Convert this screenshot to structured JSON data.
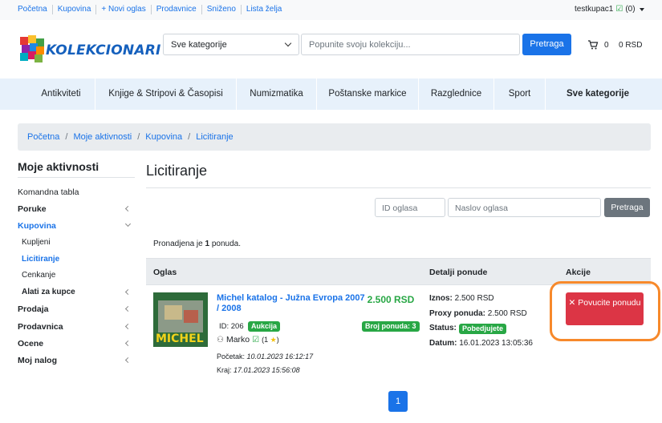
{
  "top_links": [
    "Početna",
    "Kupovina",
    "+ Novi oglas",
    "Prodavnice",
    "Sniženo",
    "Lista želja"
  ],
  "user": {
    "name": "testkupac1",
    "count": "(0)"
  },
  "header": {
    "logo_text": "KOLEKCIONARI",
    "category_select": "Sve kategorije",
    "search_placeholder": "Popunite svoju kolekciju...",
    "search_button": "Pretraga",
    "cart_count": "0",
    "cart_total": "0 RSD"
  },
  "categories": [
    "Antikviteti",
    "Knjige & Stripovi & Časopisi",
    "Numizmatika",
    "Poštanske markice",
    "Razglednice",
    "Sport",
    "Sve kategorije"
  ],
  "breadcrumb": [
    "Početna",
    "Moje aktivnosti",
    "Kupovina",
    "Licitiranje"
  ],
  "sidebar": {
    "title": "Moje aktivnosti",
    "items": {
      "komandna": "Komandna tabla",
      "poruke": "Poruke",
      "kupovina": "Kupovina",
      "kupljeni": "Kupljeni",
      "licitiranje": "Licitiranje",
      "cenkanje": "Cenkanje",
      "alati": "Alati za kupce",
      "prodaja": "Prodaja",
      "prodavnica": "Prodavnica",
      "ocene": "Ocene",
      "nalog": "Moj nalog"
    }
  },
  "main": {
    "title": "Licitiranje",
    "filter_id_placeholder": "ID oglasa",
    "filter_title_placeholder": "Naslov oglasa",
    "filter_button": "Pretraga",
    "found_prefix": "Pronadjena je ",
    "found_count": "1",
    "found_suffix": " ponuda.",
    "columns": [
      "Oglas",
      "Detalji ponude",
      "Akcije"
    ]
  },
  "row": {
    "title": "Michel katalog - Južna Evropa 2007 / 2008",
    "price": "2.500 RSD",
    "id_label": "ID: 206",
    "type_badge": "Aukcija",
    "bids_badge": "Broj ponuda: 3",
    "seller": "Marko",
    "rating_open": "(1",
    "rating_close": ")",
    "start_label": "Početak:",
    "start_value": "10.01.2023 16:12:17",
    "end_label": "Kraj:",
    "end_value": "17.01.2023 15:56:08",
    "amount_label": "Iznos:",
    "amount_value": "2.500 RSD",
    "proxy_label": "Proxy ponuda:",
    "proxy_value": "2.500 RSD",
    "status_label": "Status:",
    "status_value": "Pobedjujete",
    "date_label": "Datum:",
    "date_value": "16.01.2023 13:05:36",
    "action_button": "Povucite ponudu",
    "thumb_text": "MICHEL"
  },
  "pagination": {
    "current": "1"
  },
  "colors": {
    "primary": "#1a73e8",
    "success": "#28a745",
    "danger": "#dc3545",
    "highlight": "#f7892b"
  }
}
